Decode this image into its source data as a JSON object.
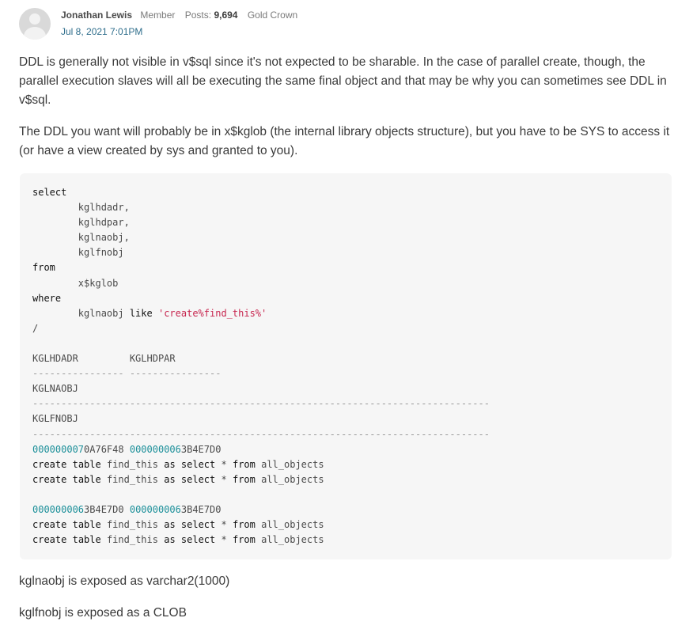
{
  "post": {
    "author": "Jonathan Lewis",
    "role": "Member",
    "posts_label": "Posts:",
    "posts_count": "9,694",
    "badge": "Gold Crown",
    "date": "Jul 8, 2021 7:01PM"
  },
  "body": {
    "paragraph1": "DDL is generally not visible in v$sql since it's not expected to be sharable. In the case of parallel create, though, the parallel execution slaves will all be executing the same final object and that may be why you can sometimes see DDL in v$sql.",
    "paragraph2": "The DDL you want will probably be in x$kglob (the internal library objects structure), but you have to be SYS to access it (or have a view created by sys and granted to you).",
    "paragraph3": "kglnaobj is exposed as varchar2(1000)",
    "paragraph4": "kglfnobj is exposed as a CLOB"
  },
  "code": {
    "kw_select": "select",
    "col1": "        kglhdadr,",
    "col2": "        kglhdpar,",
    "col3": "        kglnaobj,",
    "col4": "        kglfnobj",
    "kw_from": "from",
    "table": "        x$kglob",
    "kw_where": "where",
    "where_col": "        kglnaobj ",
    "kw_like": "like",
    "where_str": "'create%find_this%'",
    "slash": "/",
    "hdr1": "KGLHDADR         KGLHDPAR",
    "sep1": "---------------- ----------------",
    "hdr2": "KGLNAOBJ",
    "sep2": "--------------------------------------------------------------------------------",
    "hdr3": "KGLFNOBJ",
    "sep3": "--------------------------------------------------------------------------------",
    "row1_a_num": "000000007",
    "row1_a_rest": "0A76F48",
    "row1_b_num": "000000006",
    "row1_b_rest": "3B4E7D0",
    "row2_a_num": "000000006",
    "row2_a_rest": "3B4E7D0",
    "row2_b_num": "000000006",
    "row2_b_rest": "3B4E7D0",
    "stmt_create": "create",
    "stmt_table": "table",
    "stmt_name": "find_this",
    "stmt_as": "as",
    "stmt_select": "select",
    "stmt_star": "*",
    "stmt_from": "from",
    "stmt_src": "all_objects"
  }
}
